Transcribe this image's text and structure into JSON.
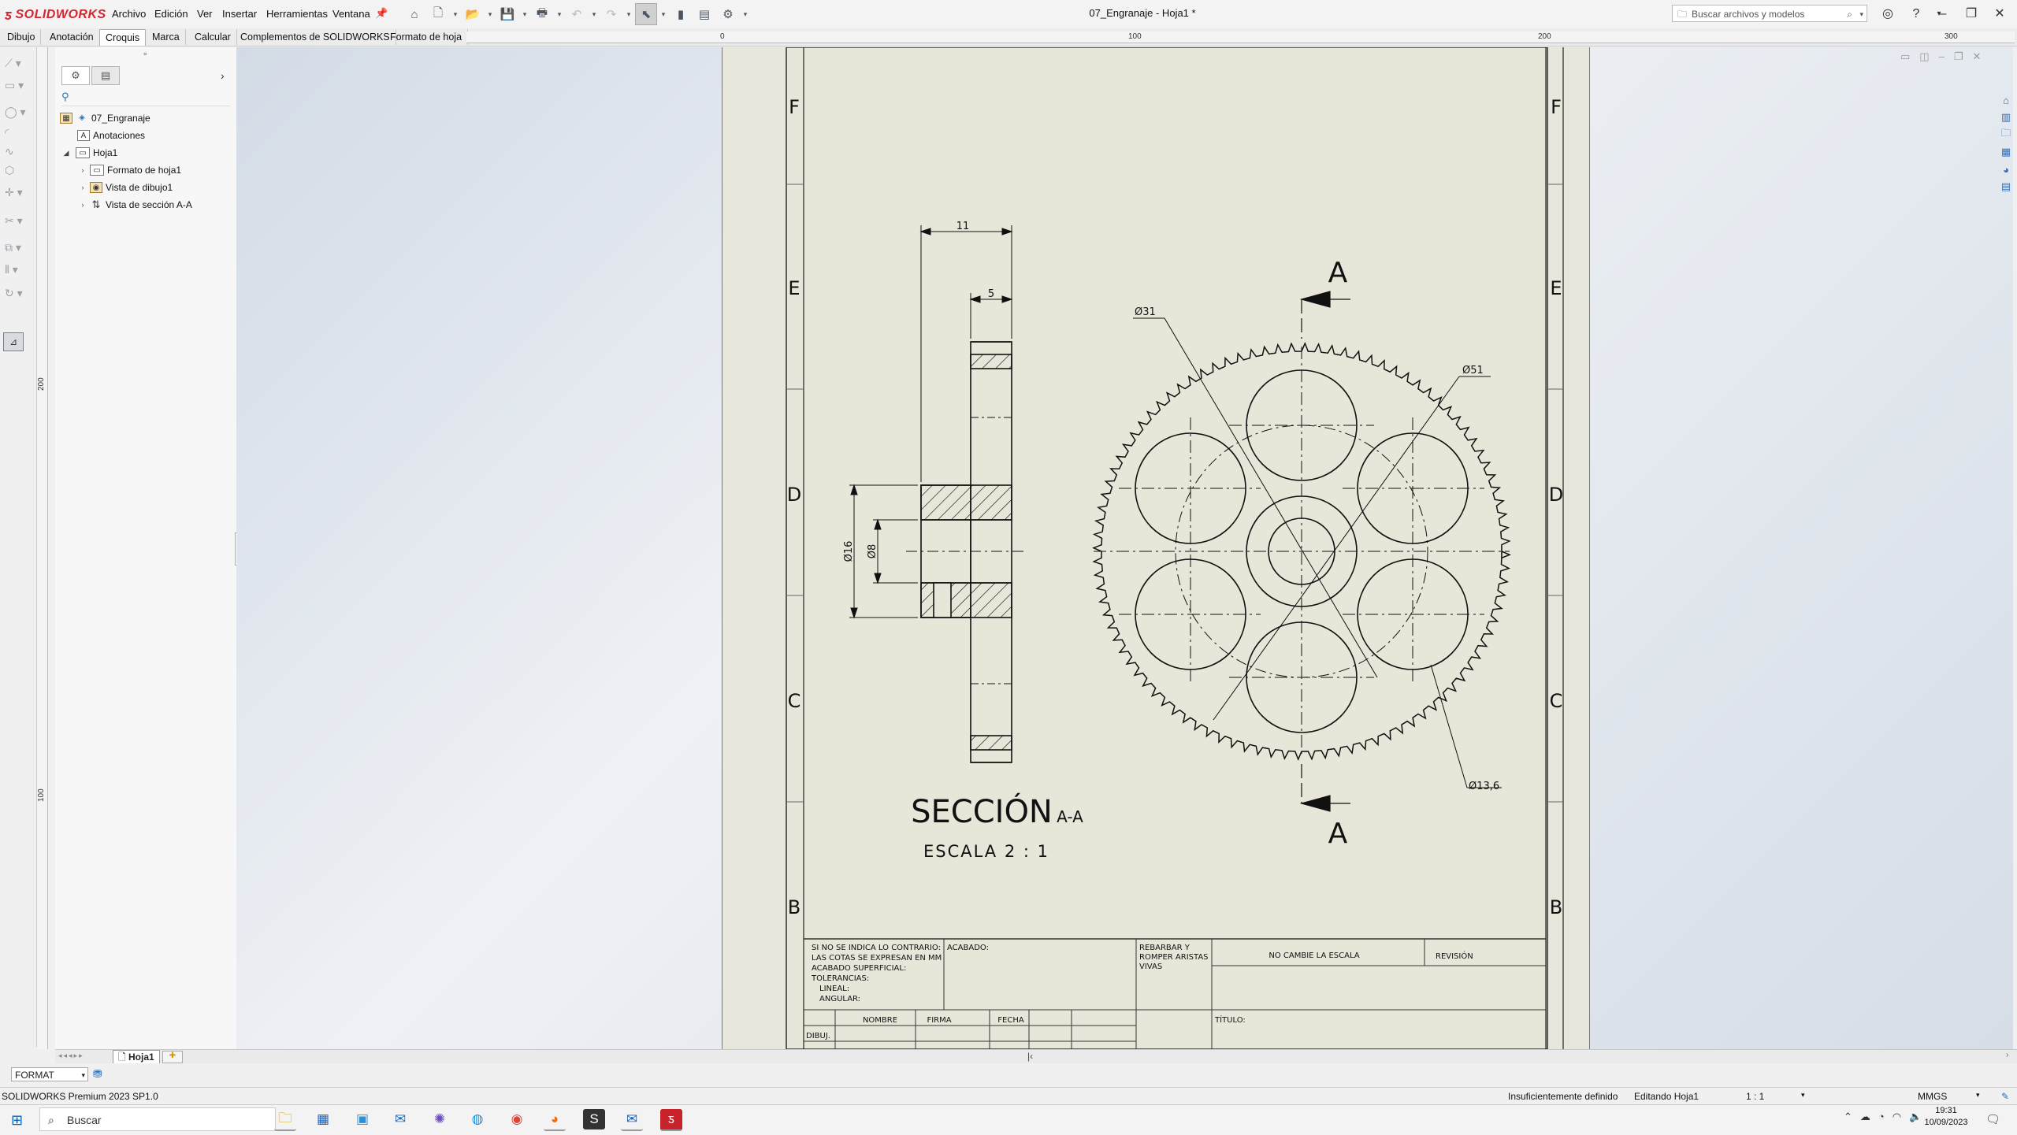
{
  "app": {
    "brand": "SOLIDWORKS",
    "document_title": "07_Engranaje - Hoja1 *",
    "menu": [
      "Archivo",
      "Edición",
      "Ver",
      "Insertar",
      "Herramientas",
      "Ventana"
    ],
    "search_placeholder": "Buscar archivos y modelos",
    "accent_color": "#d22630"
  },
  "command_tabs": [
    "Dibujo",
    "Anotación",
    "Croquis",
    "Marca",
    "Calcular",
    "Complementos de SOLIDWORKS",
    "Formato de hoja"
  ],
  "active_command_tab": "Croquis",
  "rulers": {
    "horizontal": [
      "0",
      "100",
      "200",
      "300"
    ],
    "vertical": [
      "200",
      "100"
    ]
  },
  "feature_tree": {
    "root": "07_Engranaje",
    "items": [
      {
        "label": "Anotaciones",
        "icon": "annotations-icon"
      },
      {
        "label": "Hoja1",
        "icon": "sheet-icon"
      },
      {
        "label": "Formato de hoja1",
        "icon": "sheet-format-icon"
      },
      {
        "label": "Vista de dibujo1",
        "icon": "drawing-view-icon"
      },
      {
        "label": "Vista de sección A-A",
        "icon": "section-view-icon"
      }
    ]
  },
  "drawing": {
    "zone_letters": [
      "F",
      "E",
      "D",
      "C",
      "B"
    ],
    "section_title": "SECCIÓN",
    "section_id": "A-A",
    "scale_label": "ESCALA 2 : 1",
    "cut_label": "A",
    "dims": {
      "overall_width": "11",
      "hub_width": "5",
      "bore_outer": "Ø16",
      "bore_inner": "Ø8",
      "pitch_circle": "Ø31",
      "outer_circle": "Ø51",
      "hole_dia": "Ø13,6"
    },
    "title_block": {
      "notes": [
        "SI NO SE INDICA LO CONTRARIO:",
        "LAS COTAS SE EXPRESAN EN MM",
        "ACABADO SUPERFICIAL:",
        "TOLERANCIAS:",
        "LINEAL:",
        "ANGULAR:"
      ],
      "finish": "ACABADO:",
      "deburr": [
        "REBARBAR Y",
        "ROMPER ARISTAS",
        "VIVAS"
      ],
      "no_scale": "NO CAMBIE LA ESCALA",
      "revision": "REVISIÓN",
      "columns": [
        "NOMBRE",
        "FIRMA",
        "FECHA"
      ],
      "row_dibuj": "DIBUJ.",
      "title": "TÍTULO:"
    }
  },
  "sheet_tab": "Hoja1",
  "format_select": "FORMAT",
  "status": {
    "version": "SOLIDWORKS Premium 2023 SP1.0",
    "definition": "Insuficientemente definido",
    "editing": "Editando Hoja1",
    "scale": "1 : 1",
    "units": "MMGS"
  },
  "taskbar": {
    "search": "Buscar",
    "time": "19:31",
    "date": "10/09/2023"
  }
}
